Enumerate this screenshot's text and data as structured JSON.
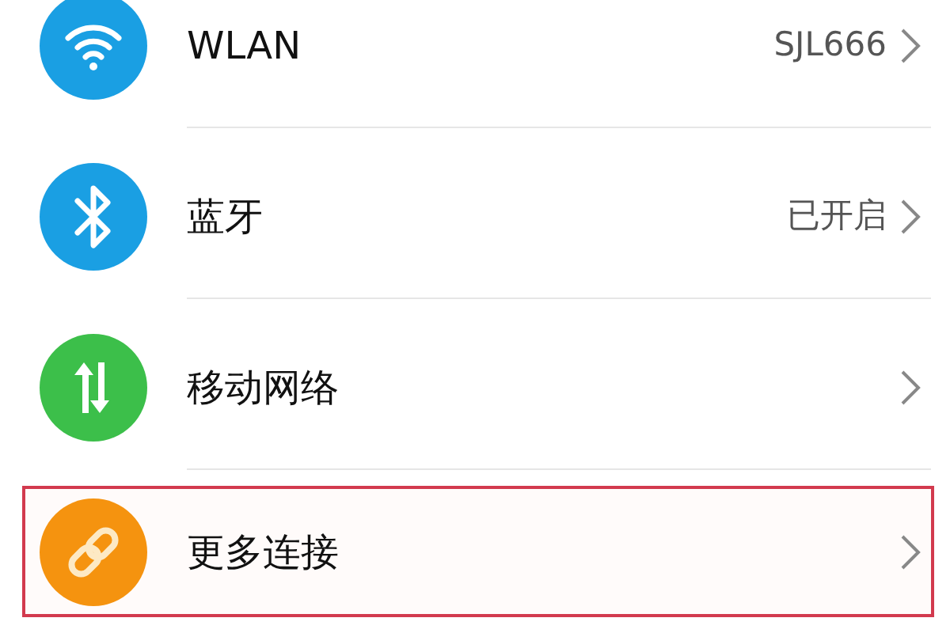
{
  "items": [
    {
      "kind": "wifi",
      "color": "#1a9fe3",
      "label": "WLAN",
      "value": "SJL666",
      "highlighted": false
    },
    {
      "kind": "bluetooth",
      "color": "#1a9fe3",
      "label": "蓝牙",
      "value": "已开启",
      "highlighted": false
    },
    {
      "kind": "mobile-data",
      "color": "#3cbf4a",
      "label": "移动网络",
      "highlighted": false
    },
    {
      "kind": "link",
      "color": "#f5930f",
      "label": "更多连接",
      "highlighted": true
    }
  ]
}
